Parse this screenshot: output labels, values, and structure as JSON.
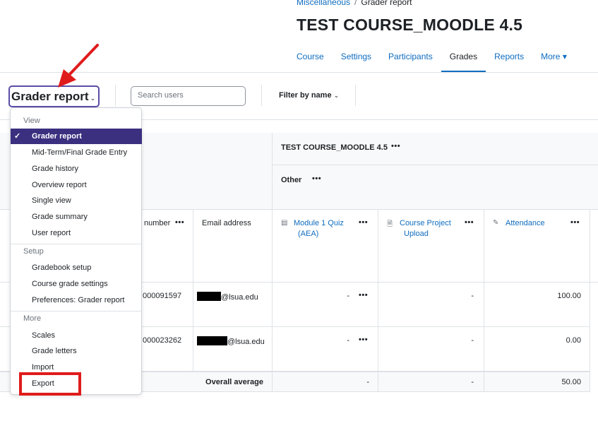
{
  "breadcrumb": {
    "parent": "Miscellaneous",
    "separator": "/",
    "current": "Grader report"
  },
  "course_title": "TEST COURSE_MOODLE 4.5",
  "nav": {
    "tabs": [
      "Course",
      "Settings",
      "Participants",
      "Grades",
      "Reports",
      "More ▾"
    ],
    "active": "Grades"
  },
  "toolbar": {
    "report_select": "Grader report",
    "search_placeholder": "Search users",
    "filter_label": "Filter by name"
  },
  "menu": {
    "sections": [
      {
        "title": "View",
        "items": [
          "Grader report",
          "Mid-Term/Final Grade Entry",
          "Grade history",
          "Overview report",
          "Single view",
          "Grade summary",
          "User report"
        ]
      },
      {
        "title": "Setup",
        "items": [
          "Gradebook setup",
          "Course grade settings",
          "Preferences: Grader report"
        ]
      },
      {
        "title": "More",
        "items": [
          "Scales",
          "Grade letters",
          "Import",
          "Export"
        ]
      }
    ],
    "selected": "Grader report",
    "highlighted": "Export"
  },
  "table": {
    "course_header": "TEST COURSE_MOODLE 4.5",
    "category_header": "Other",
    "columns": {
      "id": "ID number",
      "id_visible": "number",
      "email": "Email address",
      "quiz": "Module 1 Quiz (AEA)",
      "quiz_l1": "Module 1 Quiz",
      "quiz_l2": "(AEA)",
      "project_l1": "Course Project",
      "project_l2": "Upload",
      "attendance": "Attendance"
    },
    "rows": [
      {
        "id": "000091597",
        "email_suffix": "@lsua.edu",
        "quiz": "-",
        "project": "-",
        "attendance": "100.00"
      },
      {
        "id": "000023262",
        "email_suffix": "@lsua.edu",
        "quiz": "-",
        "project": "-",
        "attendance": "0.00"
      }
    ],
    "average": {
      "label": "Overall average",
      "quiz": "-",
      "project": "-",
      "attendance": "50.00"
    }
  },
  "colors": {
    "accent": "#0f6cbf",
    "selected": "#3b2f80",
    "annotation": "#e01b1b"
  }
}
